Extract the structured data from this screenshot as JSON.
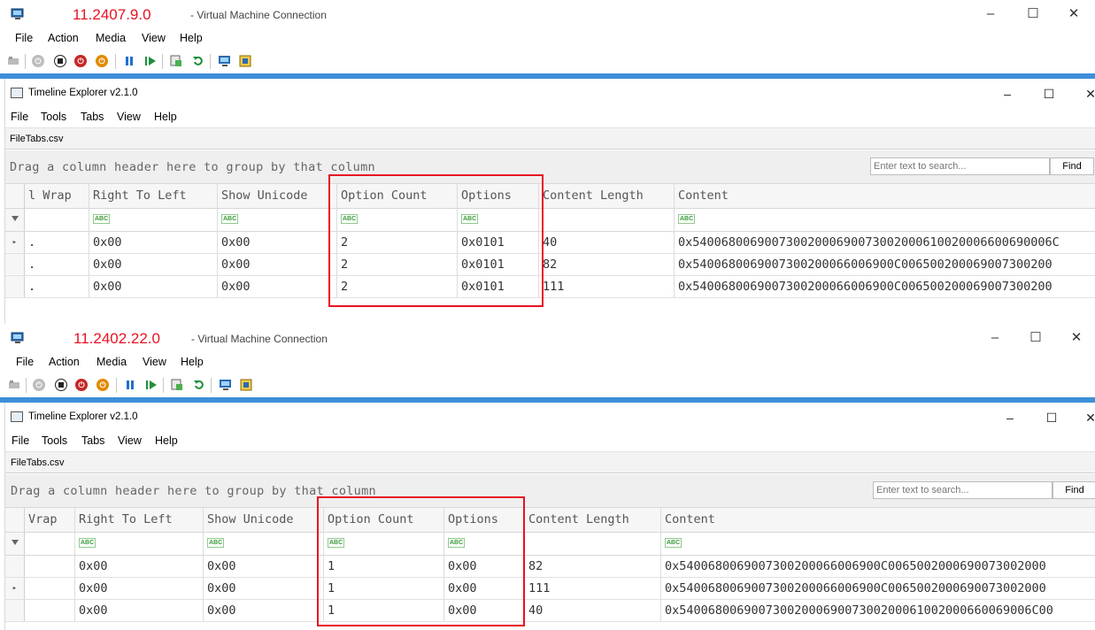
{
  "colors": {
    "version_text": "#e81123",
    "highlight_box": "#e81123",
    "vm_border": "#3d8ed9"
  },
  "vms": [
    {
      "version": "11.2407.9.0",
      "window_title": "- Virtual Machine Connection",
      "menu": [
        "File",
        "Action",
        "Media",
        "View",
        "Help"
      ],
      "toolbar_icons": [
        "ctrl-alt-del-icon",
        "start-icon",
        "turn-off-icon",
        "shut-down-icon",
        "save-icon",
        "pause-icon",
        "resume-icon",
        "checkpoint-icon",
        "revert-icon",
        "enhanced-session-icon",
        "share-icon"
      ],
      "app": {
        "title": "Timeline Explorer v2.1.0",
        "menu": [
          "File",
          "Tools",
          "Tabs",
          "View",
          "Help"
        ],
        "tab": "FileTabs.csv",
        "group_hint": "Drag a column header here to group by that column",
        "search_placeholder": "Enter text to search...",
        "find_label": "Find",
        "columns": [
          "l Wrap",
          "Right To Left",
          "Show Unicode",
          "Option Count",
          "Options",
          "Content Length",
          "Content"
        ],
        "rows": [
          [
            ".",
            "0x00",
            "0x00",
            "2",
            "0x0101",
            "40",
            "0x54006800690073002000690073002000610020006600690006C"
          ],
          [
            ".",
            "0x00",
            "0x00",
            "2",
            "0x0101",
            "82",
            "0x5400680069007300200066006900C006500200069007300200"
          ],
          [
            ".",
            "0x00",
            "0x00",
            "2",
            "0x0101",
            "111",
            "0x5400680069007300200066006900C006500200069007300200"
          ]
        ]
      }
    },
    {
      "version": "11.2402.22.0",
      "window_title": "- Virtual Machine Connection",
      "menu": [
        "File",
        "Action",
        "Media",
        "View",
        "Help"
      ],
      "toolbar_icons": [
        "ctrl-alt-del-icon",
        "start-icon",
        "turn-off-icon",
        "shut-down-icon",
        "save-icon",
        "pause-icon",
        "resume-icon",
        "checkpoint-icon",
        "revert-icon",
        "enhanced-session-icon",
        "share-icon"
      ],
      "app": {
        "title": "Timeline Explorer v2.1.0",
        "menu": [
          "File",
          "Tools",
          "Tabs",
          "View",
          "Help"
        ],
        "tab": "FileTabs.csv",
        "group_hint": "Drag a column header here to group by that column",
        "search_placeholder": "Enter text to search...",
        "find_label": "Find",
        "columns": [
          "Vrap",
          "Right To Left",
          "Show Unicode",
          "Option Count",
          "Options",
          "Content Length",
          "Content"
        ],
        "rows": [
          [
            "",
            "0x00",
            "0x00",
            "1",
            "0x00",
            "82",
            "0x5400680069007300200066006900C0065002000690073002000"
          ],
          [
            "",
            "0x00",
            "0x00",
            "1",
            "0x00",
            "111",
            "0x5400680069007300200066006900C0065002000690073002000"
          ],
          [
            "",
            "0x00",
            "0x00",
            "1",
            "0x00",
            "40",
            "0x5400680069007300200069007300200061002000660069006C00"
          ]
        ]
      }
    }
  ]
}
